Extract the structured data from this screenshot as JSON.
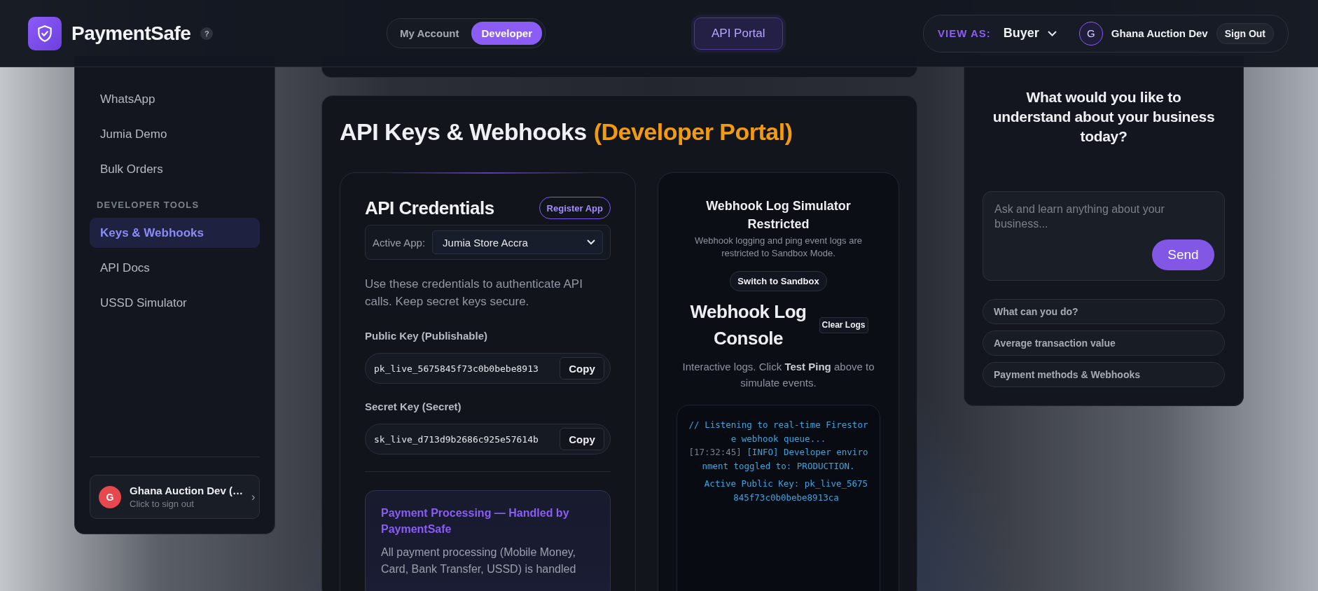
{
  "header": {
    "brand": "PaymentSafe",
    "help": "?",
    "mode_tabs": [
      {
        "label": "My Account",
        "selected": false
      },
      {
        "label": "Developer",
        "selected": true
      }
    ],
    "portal_button": "API Portal",
    "view_as": {
      "label": "VIEW AS:",
      "value": "Buyer"
    },
    "user": {
      "initial": "G",
      "name": "Ghana Auction Dev"
    },
    "sign_out": "Sign Out"
  },
  "sidebar": {
    "groups": [
      {
        "items": [
          {
            "label": "WhatsApp",
            "selected": false
          },
          {
            "label": "Jumia Demo",
            "selected": false
          },
          {
            "label": "Bulk Orders",
            "selected": false
          }
        ]
      },
      {
        "heading": "DEVELOPER TOOLS",
        "items": [
          {
            "label": "Keys & Webhooks",
            "selected": true
          },
          {
            "label": "API Docs",
            "selected": false
          },
          {
            "label": "USSD Simulator",
            "selected": false
          }
        ]
      }
    ],
    "account": {
      "initial": "G",
      "name": "Ghana Auction Dev (…",
      "hint": "Click to sign out",
      "chevron": "›"
    }
  },
  "main": {
    "title": "API Keys & Webhooks",
    "title_note": "(Developer Portal)",
    "credentials": {
      "title": "API Credentials",
      "register_button": "Register App",
      "active_app": {
        "label": "Active App:",
        "value": "Jumia Store Accra"
      },
      "description": "Use these credentials to authenticate API calls. Keep secret keys secure.",
      "keys": [
        {
          "label": "Public Key (Publishable)",
          "value": "pk_live_5675845f73c0b0bebe8913",
          "button": "Copy"
        },
        {
          "label": "Secret Key (Secret)",
          "value": "sk_live_d713d9b2686c925e57614b",
          "button": "Copy"
        }
      ],
      "notice": {
        "title": "Payment Processing — Handled by PaymentSafe",
        "text": "All payment processing (Mobile Money, Card, Bank Transfer, USSD) is handled"
      }
    },
    "webhooks": {
      "restricted_title": "Webhook Log Simulator Restricted",
      "restricted_text": "Webhook logging and ping event logs are restricted to Sandbox Mode.",
      "switch_button": "Switch to Sandbox",
      "console_title": "Webhook Log Console",
      "clear_button": "Clear Logs",
      "console_text": "Interactive logs. Click **Test Ping** above to simulate events.",
      "log": [
        {
          "kind": "comment",
          "text": "// Listening to real-time Firestore webhook queue..."
        },
        {
          "kind": "entry",
          "time": "[17:32:45]",
          "text": "[INFO] Developer environment toggled to: PRODUCTION."
        },
        {
          "kind": "detail",
          "text": "Active Public Key: pk_live_5675845f73c0b0bebe8913ca"
        }
      ]
    }
  },
  "assistant": {
    "question": "What would you like to understand about your business today?",
    "placeholder": "Ask and learn anything about your business...",
    "send_button": "Send",
    "suggestions": [
      "What can you do?",
      "Average transaction value",
      "Payment methods & Webhooks"
    ]
  }
}
